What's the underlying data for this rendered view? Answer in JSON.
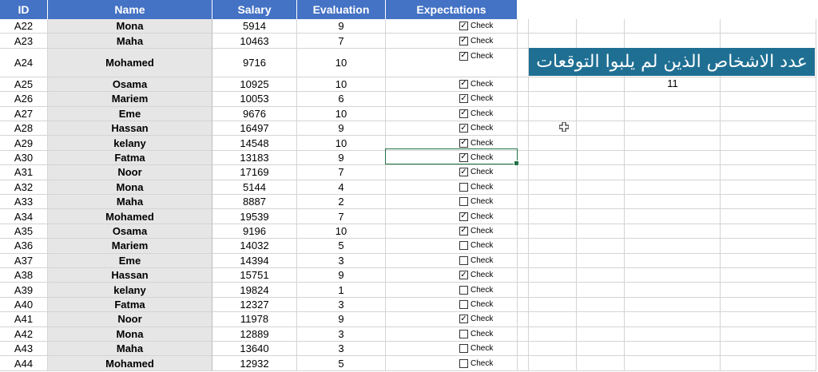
{
  "headers": [
    "ID",
    "Name",
    "Salary",
    "Evaluation",
    "Expectations"
  ],
  "checkbox_label": "Check",
  "rows": [
    {
      "id": "A22",
      "name": "Mona",
      "salary": "5914",
      "evaluation": "9",
      "checked": true
    },
    {
      "id": "A23",
      "name": "Maha",
      "salary": "10463",
      "evaluation": "7",
      "checked": true
    },
    {
      "id": "A24",
      "name": "Mohamed",
      "salary": "9716",
      "evaluation": "10",
      "checked": true
    },
    {
      "id": "A25",
      "name": "Osama",
      "salary": "10925",
      "evaluation": "10",
      "checked": true
    },
    {
      "id": "A26",
      "name": "Mariem",
      "salary": "10053",
      "evaluation": "6",
      "checked": true
    },
    {
      "id": "A27",
      "name": "Eme",
      "salary": "9676",
      "evaluation": "10",
      "checked": true
    },
    {
      "id": "A28",
      "name": "Hassan",
      "salary": "16497",
      "evaluation": "9",
      "checked": true
    },
    {
      "id": "A29",
      "name": "kelany",
      "salary": "14548",
      "evaluation": "10",
      "checked": true
    },
    {
      "id": "A30",
      "name": "Fatma",
      "salary": "13183",
      "evaluation": "9",
      "checked": true
    },
    {
      "id": "A31",
      "name": "Noor",
      "salary": "17169",
      "evaluation": "7",
      "checked": true
    },
    {
      "id": "A32",
      "name": "Mona",
      "salary": "5144",
      "evaluation": "4",
      "checked": false
    },
    {
      "id": "A33",
      "name": "Maha",
      "salary": "8887",
      "evaluation": "2",
      "checked": false
    },
    {
      "id": "A34",
      "name": "Mohamed",
      "salary": "19539",
      "evaluation": "7",
      "checked": true
    },
    {
      "id": "A35",
      "name": "Osama",
      "salary": "9196",
      "evaluation": "10",
      "checked": true
    },
    {
      "id": "A36",
      "name": "Mariem",
      "salary": "14032",
      "evaluation": "5",
      "checked": false
    },
    {
      "id": "A37",
      "name": "Eme",
      "salary": "14394",
      "evaluation": "3",
      "checked": false
    },
    {
      "id": "A38",
      "name": "Hassan",
      "salary": "15751",
      "evaluation": "9",
      "checked": true
    },
    {
      "id": "A39",
      "name": "kelany",
      "salary": "19824",
      "evaluation": "1",
      "checked": false
    },
    {
      "id": "A40",
      "name": "Fatma",
      "salary": "12327",
      "evaluation": "3",
      "checked": false
    },
    {
      "id": "A41",
      "name": "Noor",
      "salary": "11978",
      "evaluation": "9",
      "checked": true
    },
    {
      "id": "A42",
      "name": "Mona",
      "salary": "12889",
      "evaluation": "3",
      "checked": false
    },
    {
      "id": "A43",
      "name": "Maha",
      "salary": "13640",
      "evaluation": "3",
      "checked": false
    },
    {
      "id": "A44",
      "name": "Mohamed",
      "salary": "12932",
      "evaluation": "5",
      "checked": false
    }
  ],
  "banner_text": "عدد الاشخاص الذين لم يلبوا التوقعات",
  "count_value": "11",
  "colors": {
    "header_bg": "#4472c4",
    "banner_bg": "#1f6f93",
    "name_col_bg": "#e7e6e6",
    "selection": "#217346"
  }
}
